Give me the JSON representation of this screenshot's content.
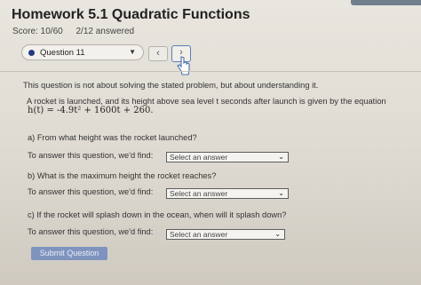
{
  "header": {
    "title": "Homework 5.1 Quadratic Functions",
    "score": "Score: 10/60",
    "answered": "2/12 answered"
  },
  "question_nav": {
    "selected": "Question 11",
    "prev_symbol": "‹",
    "next_symbol": "›"
  },
  "content": {
    "notice": "This question is not about solving the stated problem, but about understanding it.",
    "problem": "A rocket is launched, and its height above sea level t seconds after launch is given by the equation",
    "equation": "h(t) = -4.9t² + 1600t + 260.",
    "parts": [
      {
        "question": "a) From what height was the rocket launched?",
        "answer_label": "To answer this question, we'd find:",
        "select_placeholder": "Select an answer"
      },
      {
        "question": "b) What is the maximum height the rocket reaches?",
        "answer_label": "To answer this question, we'd find:",
        "select_placeholder": "Select an answer"
      },
      {
        "question": "c) If the rocket will splash down in the ocean, when will it splash down?",
        "answer_label": "To answer this question, we'd find:",
        "select_placeholder": "Select an answer"
      }
    ],
    "submit_label": "Submit Question"
  },
  "colors": {
    "accent": "#263a82",
    "submit_bg": "#7f93bf",
    "next_border": "#5a7fb8"
  }
}
